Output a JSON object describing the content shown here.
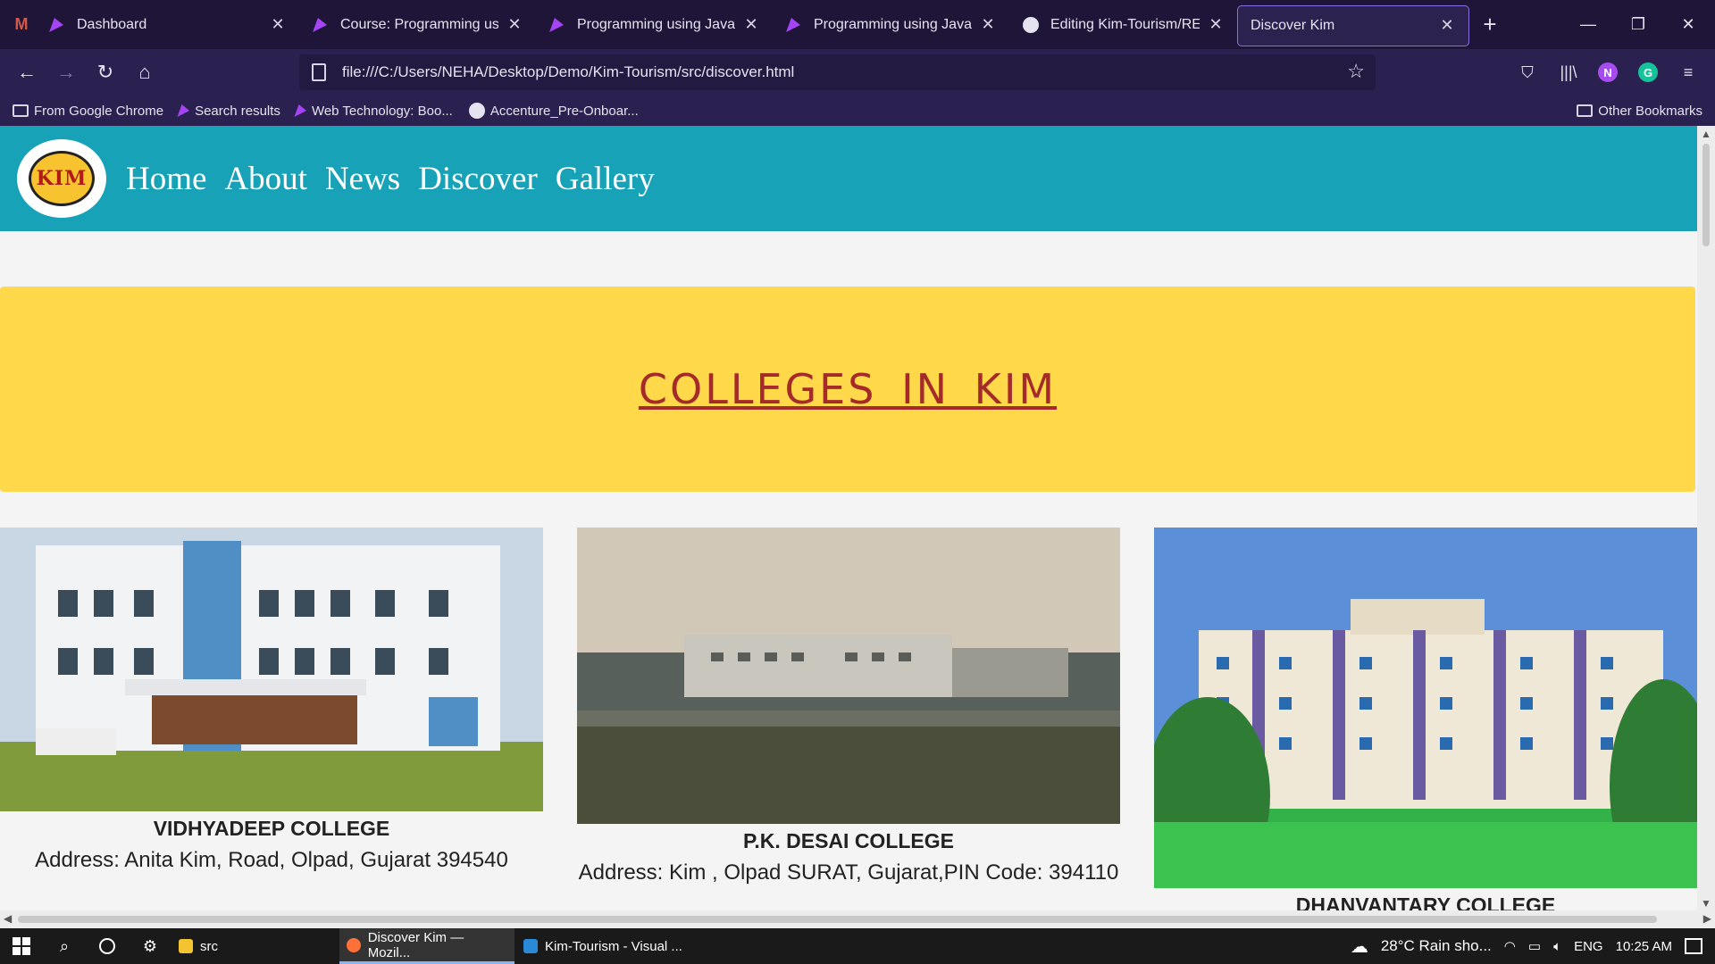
{
  "browser": {
    "tabs": [
      {
        "title": "Dashboard",
        "icon": "gmail-icon",
        "active": false
      },
      {
        "title": "Course: Programming using J",
        "icon": "course-chevron-icon",
        "active": false
      },
      {
        "title": "Programming using Java Cor",
        "icon": "course-chevron-icon",
        "active": false
      },
      {
        "title": "Programming using Java Mo",
        "icon": "course-chevron-icon",
        "active": false
      },
      {
        "title": "Editing Kim-Tourism/READM",
        "icon": "github-icon",
        "active": false
      },
      {
        "title": "Discover Kim",
        "icon": "",
        "active": true
      }
    ],
    "url": "file:///C:/Users/NEHA/Desktop/Demo/Kim-Tourism/src/discover.html",
    "profile_initial": "N",
    "extension_initial": "G",
    "bookmarks": [
      {
        "label": "From Google Chrome",
        "icon": "folder-icon"
      },
      {
        "label": "Search results",
        "icon": "bookmark-chevron-icon"
      },
      {
        "label": "Web Technology: Boo...",
        "icon": "bookmark-chevron-icon"
      },
      {
        "label": "Accenture_Pre-Onboar...",
        "icon": "github-icon"
      }
    ],
    "other_bookmarks": "Other Bookmarks"
  },
  "site": {
    "logo_text": "KIM",
    "nav": [
      "Home",
      "About",
      "News",
      "Discover",
      "Gallery"
    ],
    "banner_title": "COLLEGES IN KIM",
    "colleges": [
      {
        "name": "VIDHYADEEP COLLEGE",
        "address": "Address: Anita Kim, Road, Olpad, Gujarat 394540"
      },
      {
        "name": "P.K. DESAI COLLEGE",
        "address": "Address: Kim , Olpad SURAT, Gujarat,PIN Code: 394110"
      },
      {
        "name": "DHANVANTARY COLLEGE",
        "address": ""
      }
    ]
  },
  "taskbar": {
    "apps": [
      {
        "label": "src",
        "icon": "file-explorer-icon"
      },
      {
        "label": "Discover Kim — Mozil...",
        "icon": "firefox-icon"
      },
      {
        "label": "Kim-Tourism - Visual ...",
        "icon": "vscode-icon"
      }
    ],
    "weather": "28°C  Rain sho...",
    "language": "ENG",
    "time": "10:25 AM"
  },
  "colors": {
    "header": "#17a2b8",
    "banner": "#ffd94a",
    "banner_text": "#a52a2a",
    "browser_bg": "#2b2150"
  }
}
